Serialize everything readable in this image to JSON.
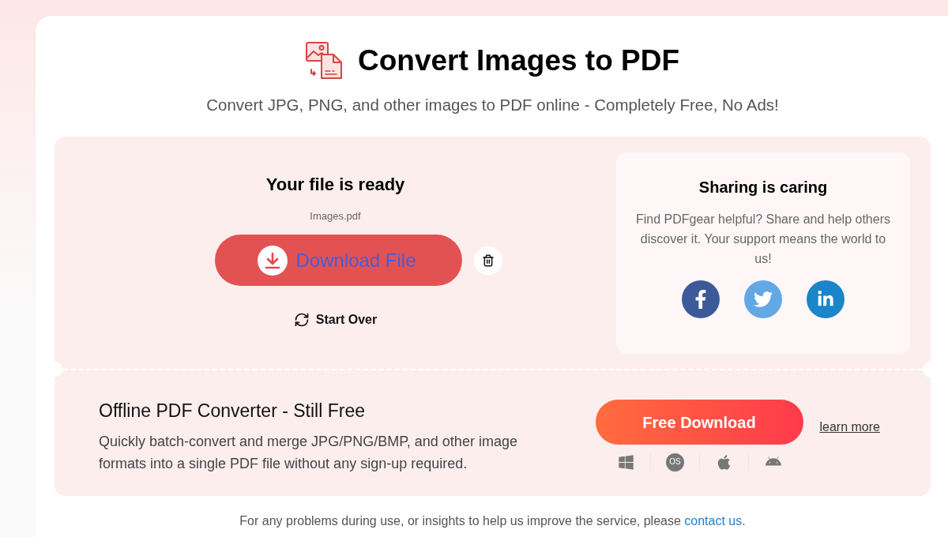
{
  "header": {
    "title": "Convert Images to PDF",
    "subtitle": "Convert JPG, PNG, and other images to PDF online - Completely Free, No Ads!"
  },
  "result": {
    "title": "Your file is ready",
    "file_name": "Images.pdf",
    "download_button": "Download File",
    "start_over": "Start Over"
  },
  "share": {
    "title": "Sharing is caring",
    "text": "Find PDFgear helpful? Share and help others discover it. Your support means the world to us!"
  },
  "offline": {
    "title": "Offline PDF Converter - Still Free",
    "text": "Quickly batch-convert and merge JPG/PNG/BMP, and other image formats into a single PDF file without any sign-up required.",
    "download_button": "Free Download",
    "learn_more": "learn more",
    "platforms": [
      {
        "kind": "windows"
      },
      {
        "kind": "macos",
        "label": "OS"
      },
      {
        "kind": "apple"
      },
      {
        "kind": "android"
      }
    ]
  },
  "footer": {
    "text": "For any problems during use, or insights to help us improve the service, please",
    "link": "contact us",
    "end": "."
  }
}
